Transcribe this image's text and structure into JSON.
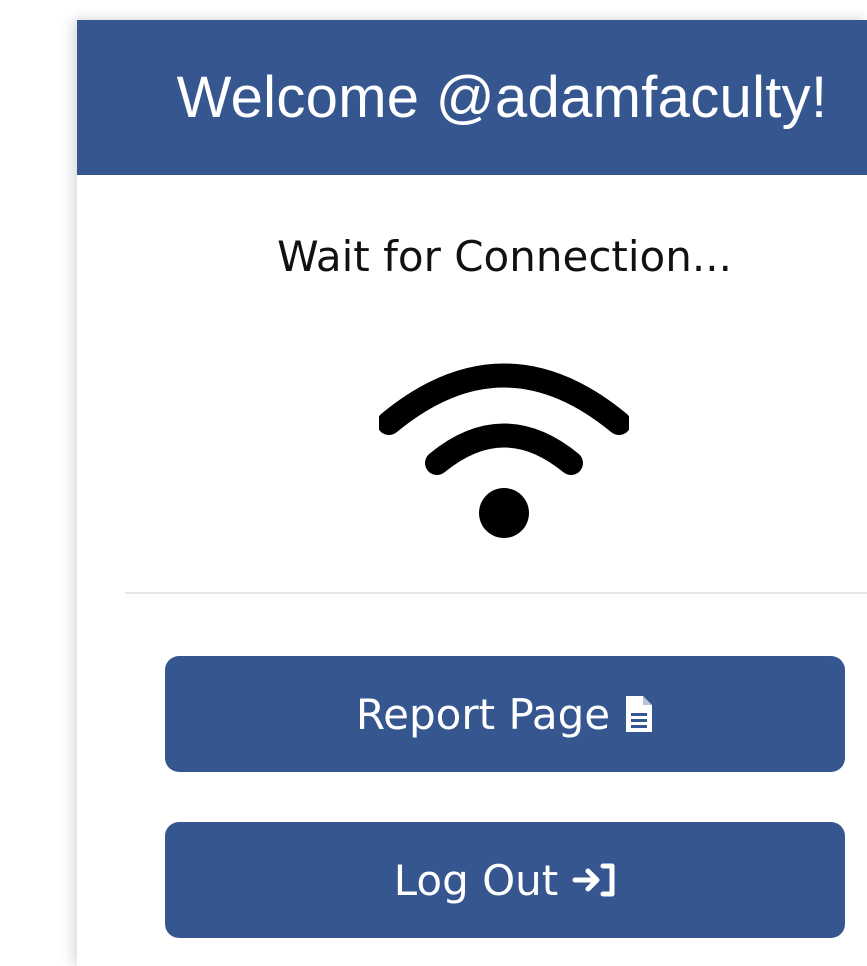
{
  "header": {
    "title": "Welcome @adamfaculty!",
    "background_color": "#365690"
  },
  "status": {
    "text": "Wait for Connection...",
    "icon": "wifi-icon"
  },
  "actions": {
    "report_label": "Report Page",
    "report_icon": "document-icon",
    "logout_label": "Log Out",
    "logout_icon": "sign-in-arrow-icon",
    "button_color": "#365690"
  }
}
